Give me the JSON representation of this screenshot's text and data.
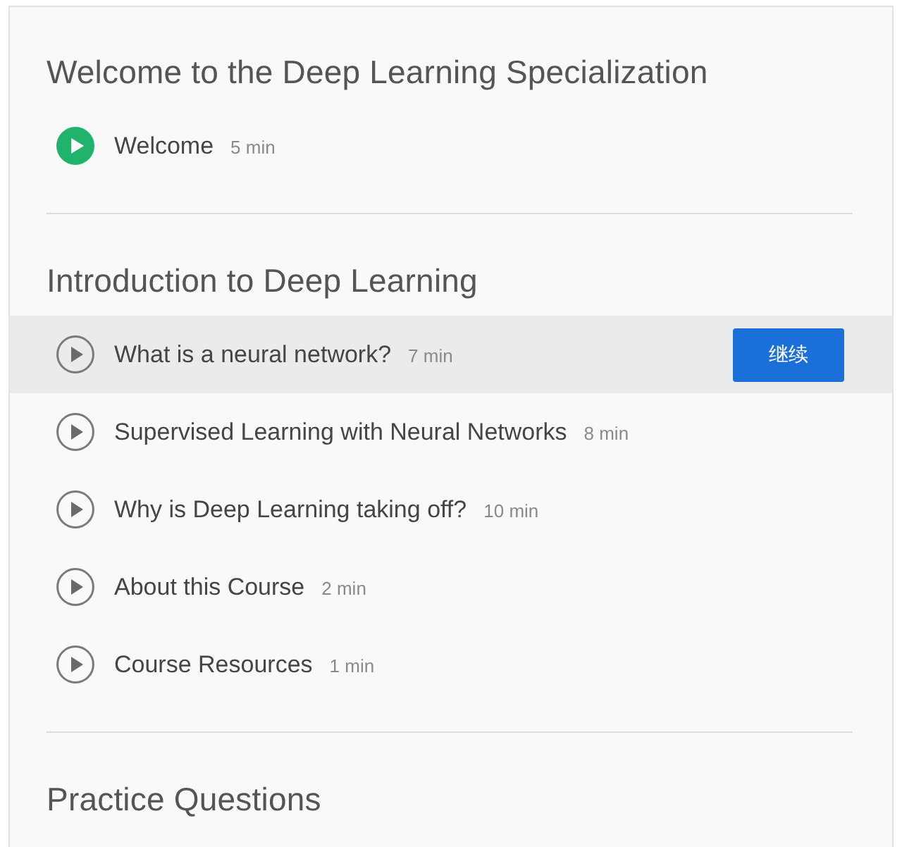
{
  "sections": [
    {
      "title": "Welcome to the Deep Learning Specialization",
      "items": [
        {
          "title": "Welcome",
          "duration": "5 min",
          "completed": true,
          "selected": false
        }
      ]
    },
    {
      "title": "Introduction to Deep Learning",
      "items": [
        {
          "title": "What is a neural network?",
          "duration": "7 min",
          "completed": false,
          "selected": true,
          "action": "继续"
        },
        {
          "title": "Supervised Learning with Neural Networks",
          "duration": "8 min",
          "completed": false,
          "selected": false
        },
        {
          "title": "Why is Deep Learning taking off?",
          "duration": "10 min",
          "completed": false,
          "selected": false
        },
        {
          "title": "About this Course",
          "duration": "2 min",
          "completed": false,
          "selected": false
        },
        {
          "title": "Course Resources",
          "duration": "1 min",
          "completed": false,
          "selected": false
        }
      ]
    },
    {
      "title": "Practice Questions"
    }
  ]
}
